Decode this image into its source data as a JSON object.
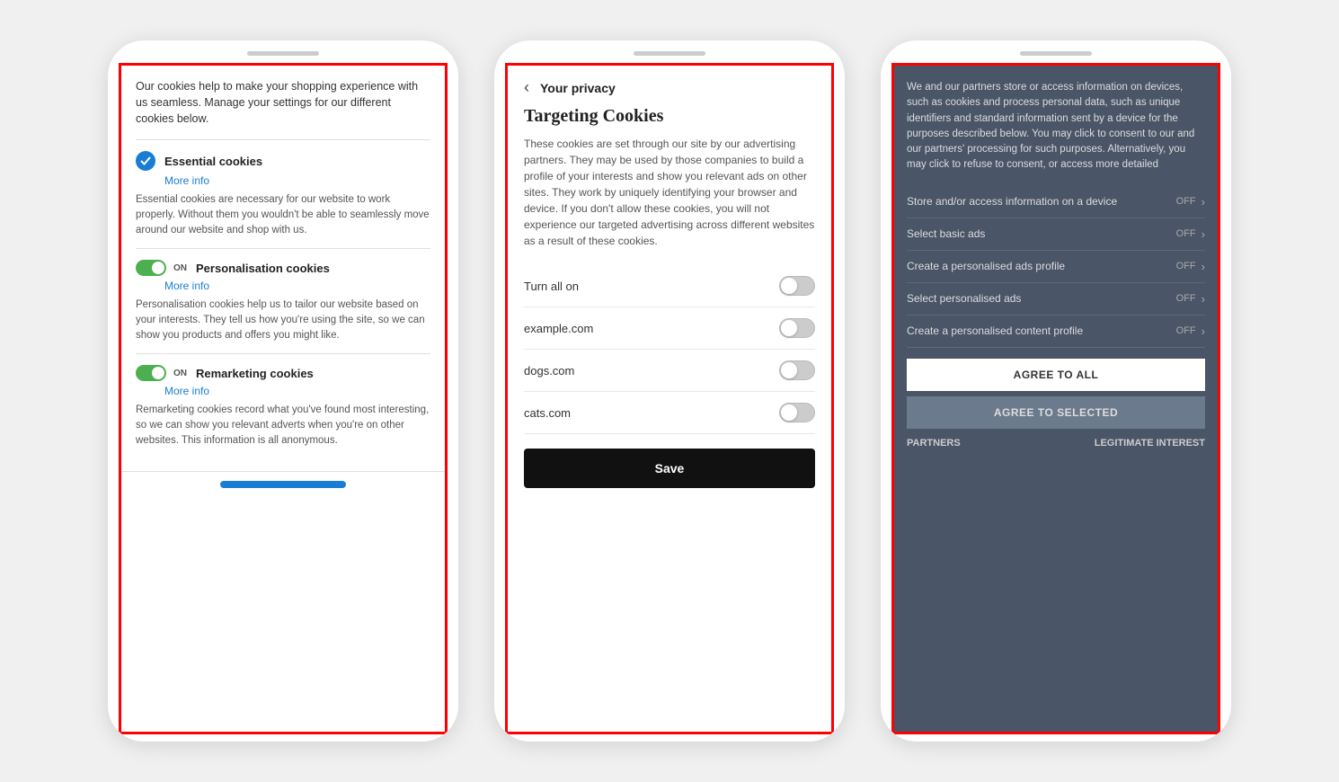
{
  "phone1": {
    "intro": "Our cookies help to make your shopping experience with us seamless. Manage your settings for our different cookies below.",
    "sections": [
      {
        "id": "essential",
        "icon_type": "check",
        "title": "Essential cookies",
        "more_info": "More info",
        "description": "Essential cookies are necessary for our website to work properly. Without them you wouldn't be able to seamlessly move around our website and shop with us.",
        "toggle": null,
        "toggle_label": null
      },
      {
        "id": "personalisation",
        "icon_type": "toggle",
        "title": "Personalisation cookies",
        "more_info": "More info",
        "toggle_state": "on",
        "toggle_label": "ON",
        "description": "Personalisation cookies help us to tailor our website based on your interests. They tell us how you're using the site, so we can show you products and offers you might like."
      },
      {
        "id": "remarketing",
        "icon_type": "toggle",
        "title": "Remarketing cookies",
        "more_info": "More info",
        "toggle_state": "on",
        "toggle_label": "ON",
        "description": "Remarketing cookies record what you've found most interesting, so we can show you relevant adverts when you're on other websites. This information is all anonymous."
      }
    ]
  },
  "phone2": {
    "back_label": "‹",
    "nav_title": "Your privacy",
    "section_title": "Targeting Cookies",
    "description": "These cookies are set through our site by our advertising partners. They may be used by those companies to build a profile of your interests and show you relevant ads on other sites. They work by uniquely identifying your browser and device. If you don't allow these cookies, you will not experience our targeted advertising across different websites as a result of these cookies.",
    "turn_all_on": "Turn all on",
    "rows": [
      {
        "label": "Turn all on"
      },
      {
        "label": "example.com"
      },
      {
        "label": "dogs.com"
      },
      {
        "label": "cats.com"
      }
    ],
    "save_label": "Save"
  },
  "phone3": {
    "intro": "We and our partners store or access information on devices, such as cookies and process personal data, such as unique identifiers and standard information sent by a device for the purposes described below. You may click to consent to our and our partners' processing for such purposes. Alternatively, you may click to refuse to consent, or access more detailed",
    "rows": [
      {
        "label": "Store and/or access information on a device",
        "status": "OFF"
      },
      {
        "label": "Select basic ads",
        "status": "OFF"
      },
      {
        "label": "Create a personalised ads profile",
        "status": "OFF"
      },
      {
        "label": "Select personalised ads",
        "status": "OFF"
      },
      {
        "label": "Create a personalised content profile",
        "status": "OFF"
      }
    ],
    "agree_all": "AGREE TO ALL",
    "agree_selected": "AGREE TO SELECTED",
    "partners": "PARTNERS",
    "legitimate_interest": "LEGITIMATE INTEREST"
  }
}
